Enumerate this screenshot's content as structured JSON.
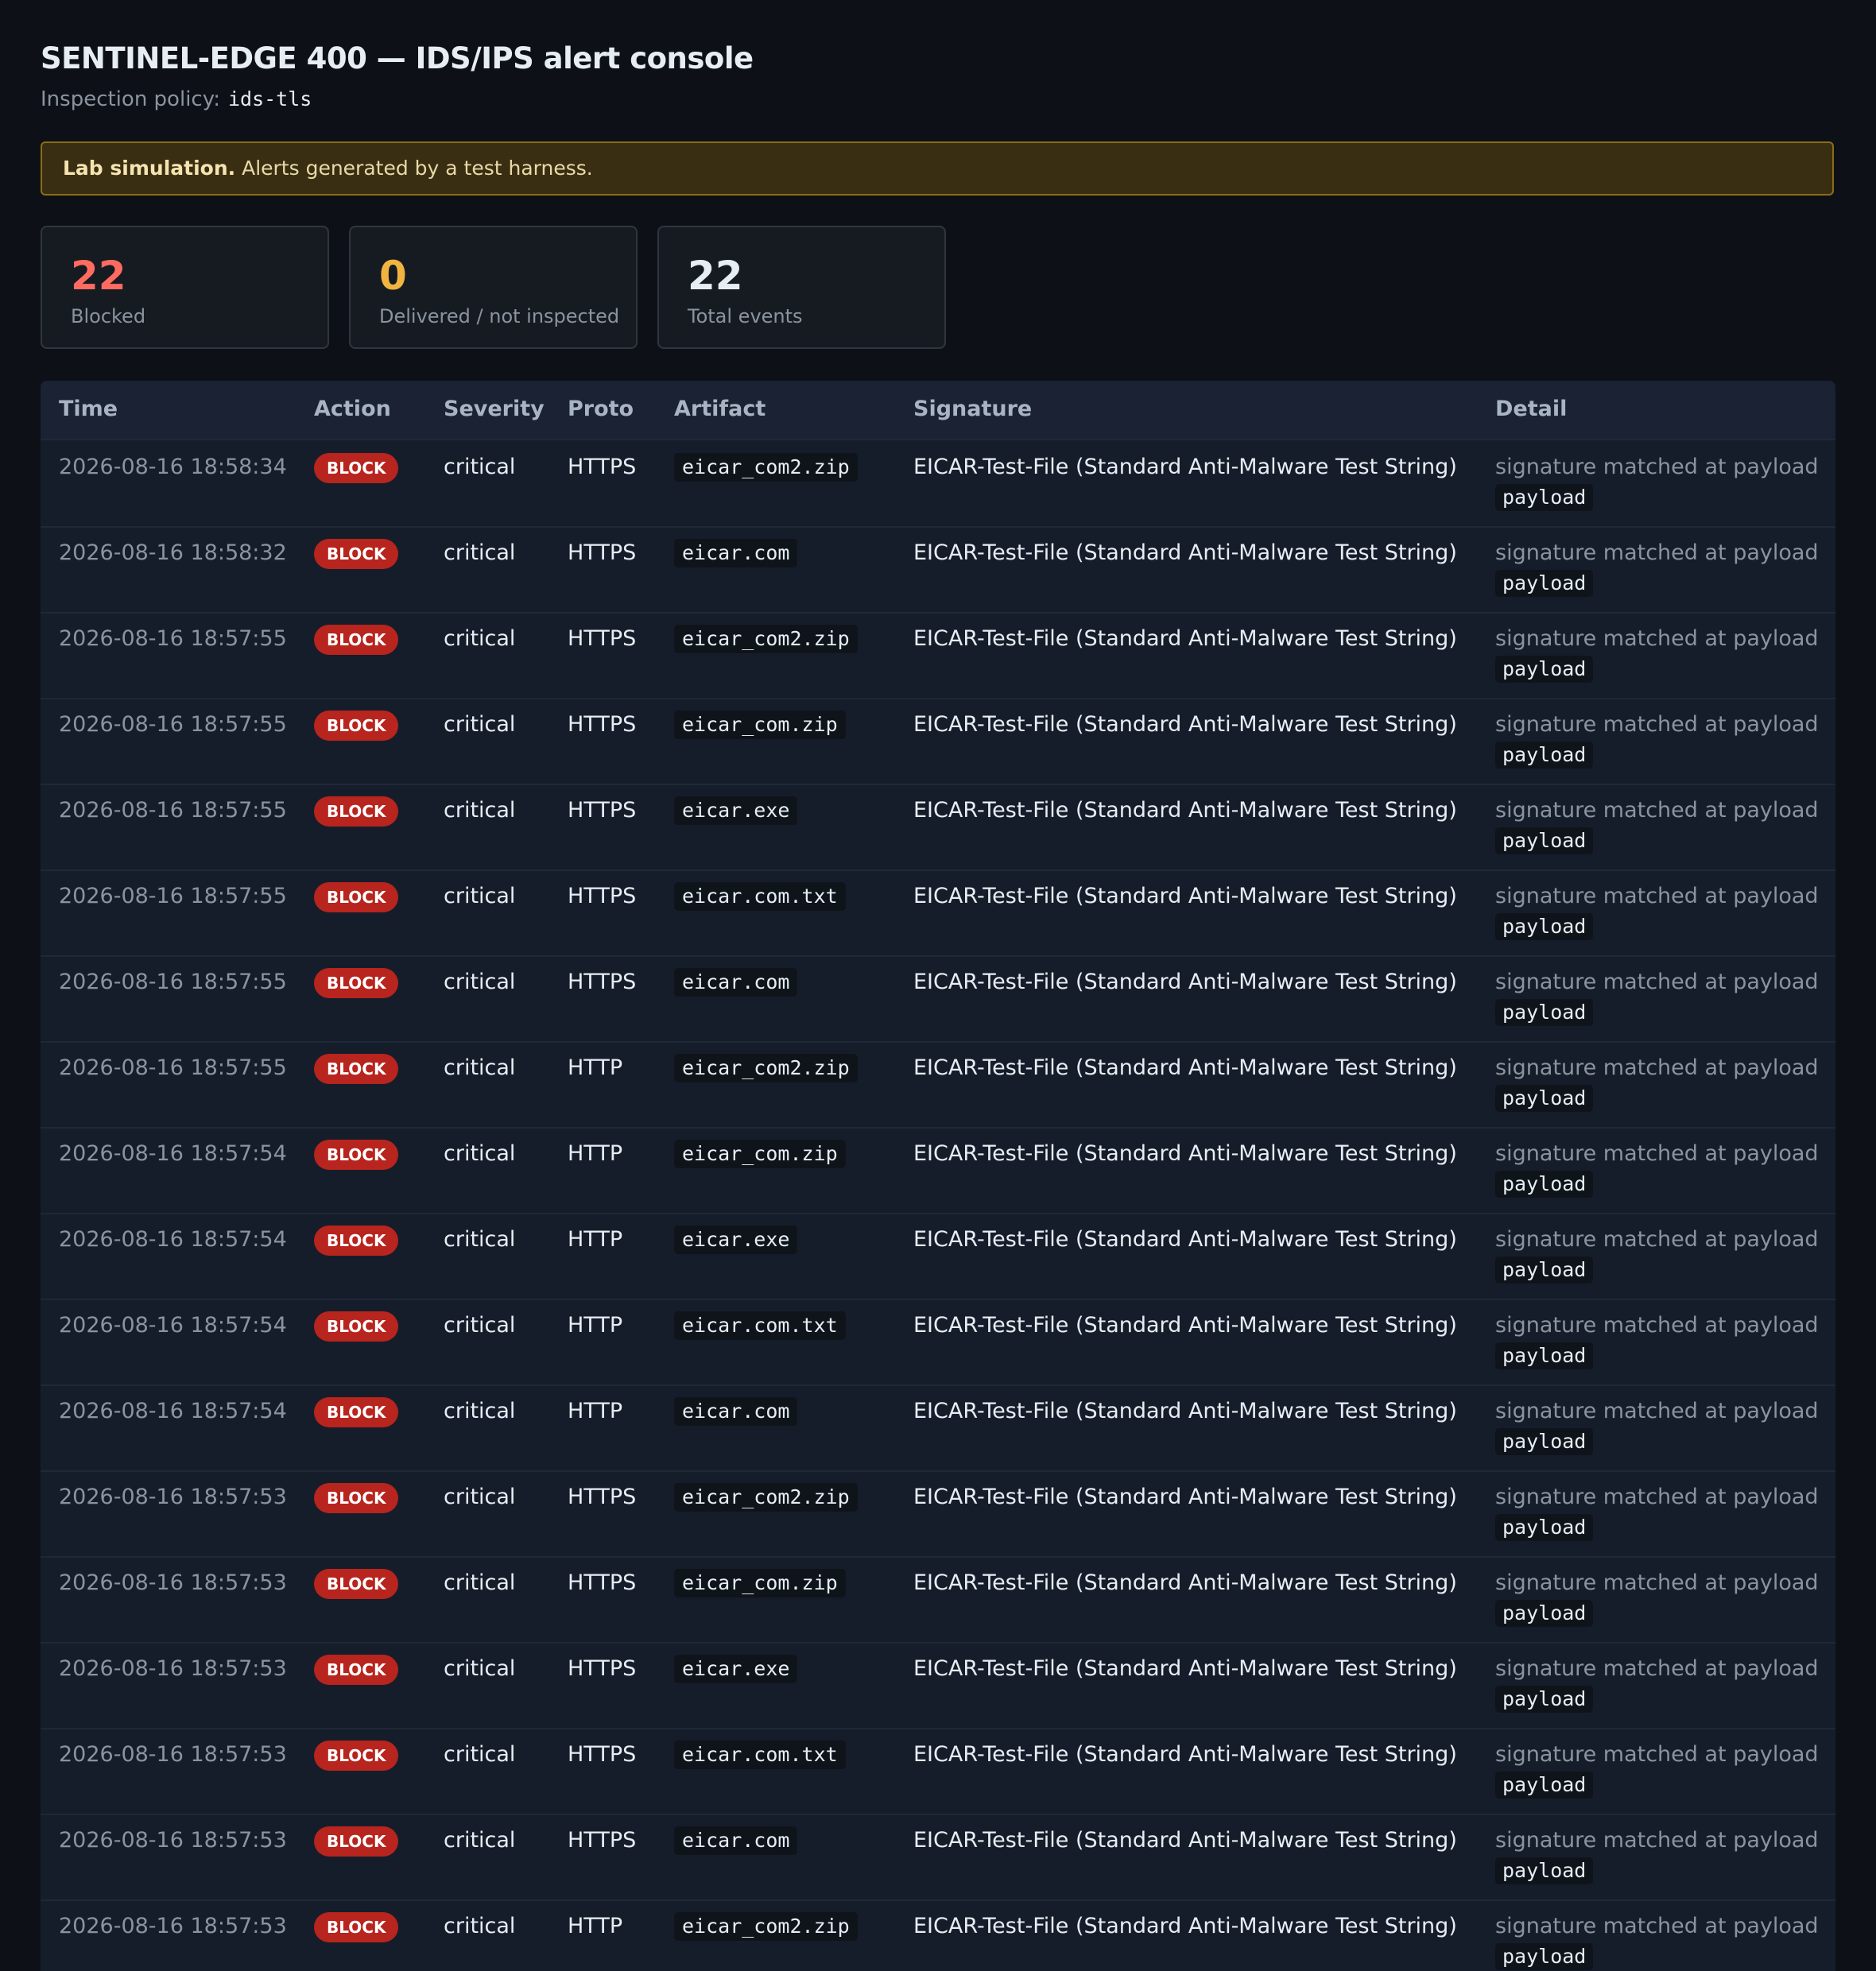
{
  "header": {
    "title": "SENTINEL-EDGE 400 — IDS/IPS alert console",
    "policy_label": "Inspection policy:",
    "policy_value": "ids-tls"
  },
  "banner": {
    "bold": "Lab simulation.",
    "text": "Alerts generated by a test harness."
  },
  "stats": [
    {
      "value": "22",
      "label": "Blocked",
      "color": "#ff6b61"
    },
    {
      "value": "0",
      "label": "Delivered / not inspected",
      "color": "#f2b441"
    },
    {
      "value": "22",
      "label": "Total events",
      "color": "#e6edf3"
    }
  ],
  "table": {
    "columns": [
      "Time",
      "Action",
      "Severity",
      "Proto",
      "Artifact",
      "Signature",
      "Detail"
    ],
    "rows": [
      {
        "time": "2026-08-16 18:58:34",
        "action": "BLOCK",
        "severity": "critical",
        "proto": "HTTPS",
        "artifact": "eicar_com2.zip",
        "signature": "EICAR-Test-File (Standard Anti-Malware Test String)",
        "detail": "signature matched at payload",
        "detail_code": "payload"
      },
      {
        "time": "2026-08-16 18:58:32",
        "action": "BLOCK",
        "severity": "critical",
        "proto": "HTTPS",
        "artifact": "eicar.com",
        "signature": "EICAR-Test-File (Standard Anti-Malware Test String)",
        "detail": "signature matched at payload",
        "detail_code": "payload"
      },
      {
        "time": "2026-08-16 18:57:55",
        "action": "BLOCK",
        "severity": "critical",
        "proto": "HTTPS",
        "artifact": "eicar_com2.zip",
        "signature": "EICAR-Test-File (Standard Anti-Malware Test String)",
        "detail": "signature matched at payload",
        "detail_code": "payload"
      },
      {
        "time": "2026-08-16 18:57:55",
        "action": "BLOCK",
        "severity": "critical",
        "proto": "HTTPS",
        "artifact": "eicar_com.zip",
        "signature": "EICAR-Test-File (Standard Anti-Malware Test String)",
        "detail": "signature matched at payload",
        "detail_code": "payload"
      },
      {
        "time": "2026-08-16 18:57:55",
        "action": "BLOCK",
        "severity": "critical",
        "proto": "HTTPS",
        "artifact": "eicar.exe",
        "signature": "EICAR-Test-File (Standard Anti-Malware Test String)",
        "detail": "signature matched at payload",
        "detail_code": "payload"
      },
      {
        "time": "2026-08-16 18:57:55",
        "action": "BLOCK",
        "severity": "critical",
        "proto": "HTTPS",
        "artifact": "eicar.com.txt",
        "signature": "EICAR-Test-File (Standard Anti-Malware Test String)",
        "detail": "signature matched at payload",
        "detail_code": "payload"
      },
      {
        "time": "2026-08-16 18:57:55",
        "action": "BLOCK",
        "severity": "critical",
        "proto": "HTTPS",
        "artifact": "eicar.com",
        "signature": "EICAR-Test-File (Standard Anti-Malware Test String)",
        "detail": "signature matched at payload",
        "detail_code": "payload"
      },
      {
        "time": "2026-08-16 18:57:55",
        "action": "BLOCK",
        "severity": "critical",
        "proto": "HTTP",
        "artifact": "eicar_com2.zip",
        "signature": "EICAR-Test-File (Standard Anti-Malware Test String)",
        "detail": "signature matched at payload",
        "detail_code": "payload"
      },
      {
        "time": "2026-08-16 18:57:54",
        "action": "BLOCK",
        "severity": "critical",
        "proto": "HTTP",
        "artifact": "eicar_com.zip",
        "signature": "EICAR-Test-File (Standard Anti-Malware Test String)",
        "detail": "signature matched at payload",
        "detail_code": "payload"
      },
      {
        "time": "2026-08-16 18:57:54",
        "action": "BLOCK",
        "severity": "critical",
        "proto": "HTTP",
        "artifact": "eicar.exe",
        "signature": "EICAR-Test-File (Standard Anti-Malware Test String)",
        "detail": "signature matched at payload",
        "detail_code": "payload"
      },
      {
        "time": "2026-08-16 18:57:54",
        "action": "BLOCK",
        "severity": "critical",
        "proto": "HTTP",
        "artifact": "eicar.com.txt",
        "signature": "EICAR-Test-File (Standard Anti-Malware Test String)",
        "detail": "signature matched at payload",
        "detail_code": "payload"
      },
      {
        "time": "2026-08-16 18:57:54",
        "action": "BLOCK",
        "severity": "critical",
        "proto": "HTTP",
        "artifact": "eicar.com",
        "signature": "EICAR-Test-File (Standard Anti-Malware Test String)",
        "detail": "signature matched at payload",
        "detail_code": "payload"
      },
      {
        "time": "2026-08-16 18:57:53",
        "action": "BLOCK",
        "severity": "critical",
        "proto": "HTTPS",
        "artifact": "eicar_com2.zip",
        "signature": "EICAR-Test-File (Standard Anti-Malware Test String)",
        "detail": "signature matched at payload",
        "detail_code": "payload"
      },
      {
        "time": "2026-08-16 18:57:53",
        "action": "BLOCK",
        "severity": "critical",
        "proto": "HTTPS",
        "artifact": "eicar_com.zip",
        "signature": "EICAR-Test-File (Standard Anti-Malware Test String)",
        "detail": "signature matched at payload",
        "detail_code": "payload"
      },
      {
        "time": "2026-08-16 18:57:53",
        "action": "BLOCK",
        "severity": "critical",
        "proto": "HTTPS",
        "artifact": "eicar.exe",
        "signature": "EICAR-Test-File (Standard Anti-Malware Test String)",
        "detail": "signature matched at payload",
        "detail_code": "payload"
      },
      {
        "time": "2026-08-16 18:57:53",
        "action": "BLOCK",
        "severity": "critical",
        "proto": "HTTPS",
        "artifact": "eicar.com.txt",
        "signature": "EICAR-Test-File (Standard Anti-Malware Test String)",
        "detail": "signature matched at payload",
        "detail_code": "payload"
      },
      {
        "time": "2026-08-16 18:57:53",
        "action": "BLOCK",
        "severity": "critical",
        "proto": "HTTPS",
        "artifact": "eicar.com",
        "signature": "EICAR-Test-File (Standard Anti-Malware Test String)",
        "detail": "signature matched at payload",
        "detail_code": "payload"
      },
      {
        "time": "2026-08-16 18:57:53",
        "action": "BLOCK",
        "severity": "critical",
        "proto": "HTTP",
        "artifact": "eicar_com2.zip",
        "signature": "EICAR-Test-File (Standard Anti-Malware Test String)",
        "detail": "signature matched at payload",
        "detail_code": "payload"
      }
    ]
  }
}
